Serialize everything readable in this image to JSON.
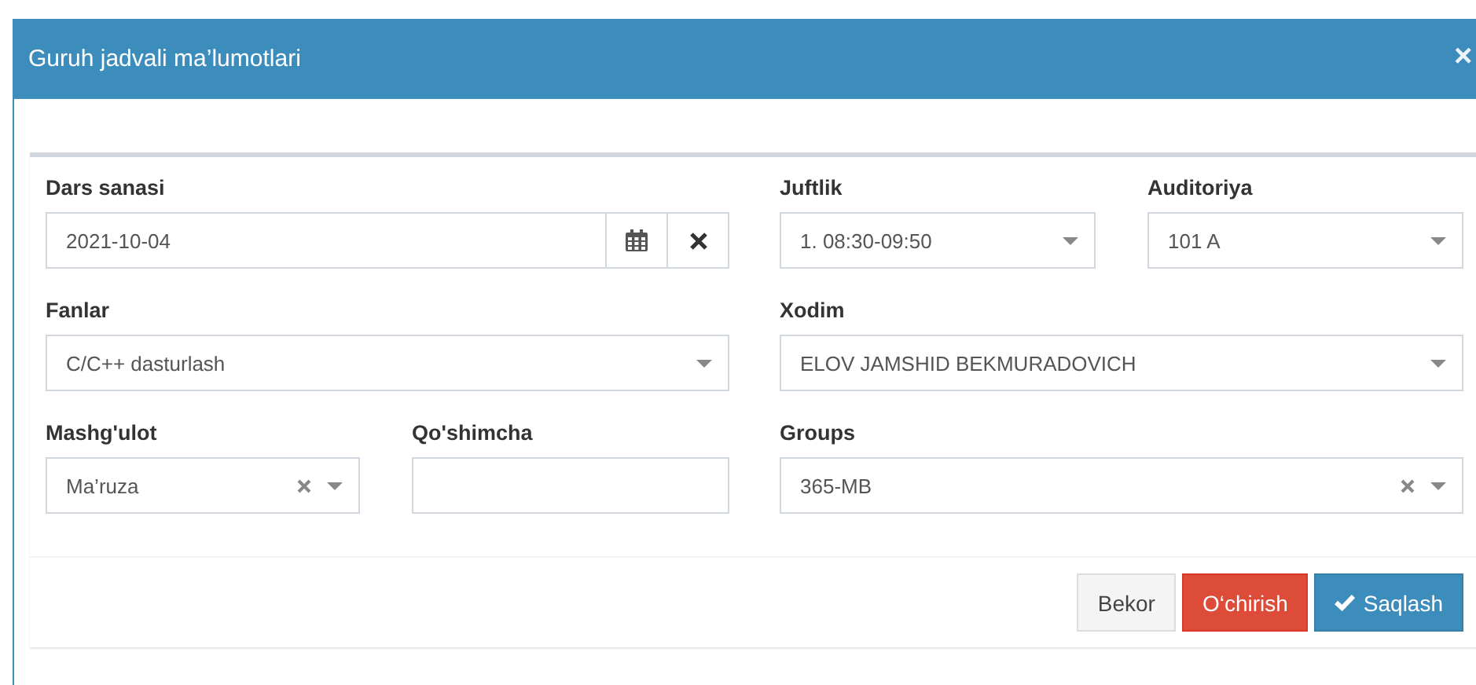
{
  "window": {
    "title": "Guruh jadvali ma’lumotlari",
    "close": "×"
  },
  "form": {
    "left_rows": [
      [
        {
          "label": "Dars sanasi",
          "kind": "date",
          "value": "2021-10-04"
        }
      ],
      [
        {
          "label": "Fanlar",
          "kind": "select",
          "value": "C/C++ dasturlash",
          "clear_button": false
        }
      ],
      [
        {
          "label": "Mashg'ulot",
          "kind": "select",
          "value": "Ma’ruza",
          "clear_button": true
        },
        {
          "label": "Qo'shimcha",
          "kind": "text"
        }
      ]
    ],
    "right_rows": [
      [
        {
          "label": "Juftlik",
          "kind": "select",
          "value": "1. 08:30-09:50",
          "clear_button": false
        },
        {
          "label": "Auditoriya",
          "kind": "select",
          "value": "101 A",
          "clear_button": false
        }
      ],
      [
        {
          "label": "Xodim",
          "kind": "select",
          "value": "ELOV JAMSHID BEKMURADOVICH",
          "clear_button": false
        }
      ],
      [
        {
          "label": "Groups",
          "kind": "select",
          "value": "365-MB",
          "clear_button": true
        }
      ]
    ]
  },
  "buttons": [
    {
      "label": "Bekor",
      "kind": "default"
    },
    {
      "label": "O‘chirish",
      "kind": "danger"
    },
    {
      "label": "Saqlash",
      "kind": "primary"
    }
  ]
}
